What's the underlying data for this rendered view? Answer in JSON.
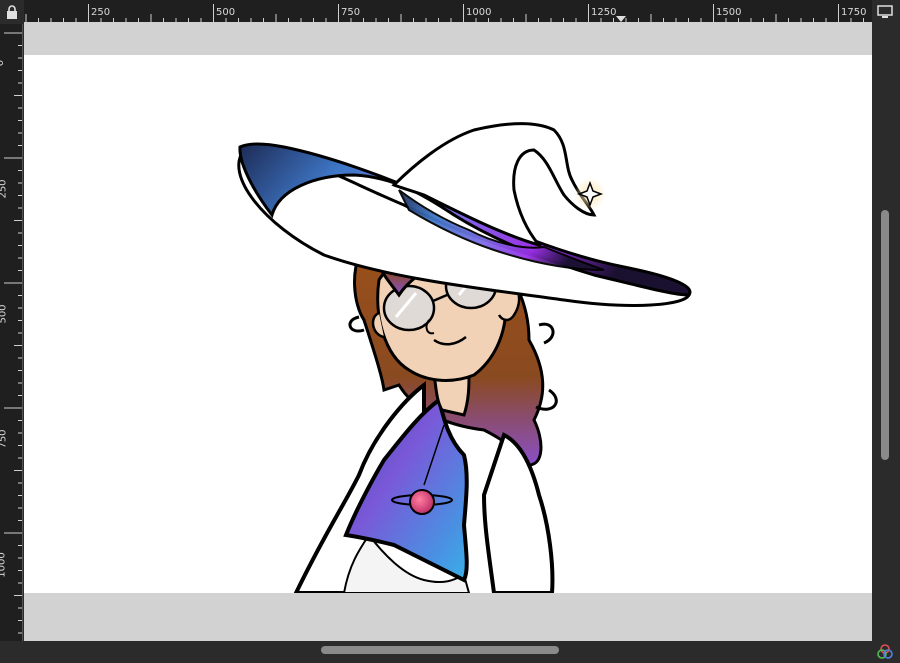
{
  "rulers": {
    "horizontal_labels": [
      "250",
      "500",
      "750",
      "1000",
      "1250",
      "1500",
      "1750"
    ],
    "vertical_labels": [
      "0",
      "250",
      "500",
      "750",
      "1000"
    ]
  },
  "icons": {
    "lock": "lock-icon",
    "display": "display-icon",
    "color_management": "color-management-icon"
  },
  "colors": {
    "background": "#2b2b2b",
    "ruler": "#1f1f1f",
    "canvas_surround": "#d2d2d2",
    "page": "#ffffff",
    "hat_purple": "#9b30e8",
    "hat_blue": "#4a90e2",
    "hair_brown": "#9a4f1a",
    "skin": "#f1d2b6"
  }
}
